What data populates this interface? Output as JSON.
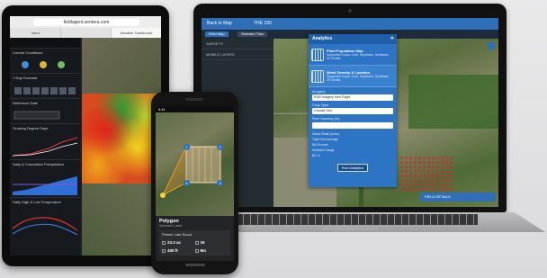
{
  "tablet": {
    "url": "fieldagent.sentera.com",
    "tabs": [
      "Inbox",
      "",
      "Weather Dashboard"
    ],
    "panels": [
      {
        "label": "Current Conditions"
      },
      {
        "label": "7-Day Forecast"
      },
      {
        "label": "Reference Date"
      },
      {
        "label": "Growing Degree Days"
      },
      {
        "label": "Daily & Cumulative Precipitation"
      },
      {
        "label": "Daily High & Low Temperature"
      }
    ],
    "colors": {
      "heat_red": "#e3251b",
      "heat_yellow": "#f2d21b",
      "heat_green": "#2b9a35"
    }
  },
  "laptop": {
    "topbar": {
      "back": "Back to Map",
      "field": "THE 100"
    },
    "nav": {
      "field_map": "Field Map",
      "selected": "Selected Tiles"
    },
    "sidebar": [
      "SURVEYS",
      "MOBILE LAYERS"
    ],
    "analytics": {
      "title": "Analytics",
      "close": "✕",
      "options": [
        {
          "name": "Plant Population Map",
          "desc": "Supported Crops: Corn, Soybeans, Sunflower",
          "extra": "20 Credits",
          "icon": "plant-population-icon",
          "icon_label": "Population"
        },
        {
          "name": "Weed Density & Location",
          "desc": "Supported Crops: Corn, Soybeans, Sunflower",
          "extra": "20 Credits",
          "icon": "weed-density-icon",
          "icon_label": "Weeds"
        }
      ],
      "imagery_label": "Imagery",
      "imagery_value": "RGB Imagery from Flight",
      "crop_label": "Crop Type",
      "crop_value": "Choose One",
      "row_spacing_label": "Row Spacing (in)",
      "seed_rate_label": "Seed Rate (s/ac)",
      "total_acreage_label": "Total Field Acreage",
      "total_acreage_value": "86.16 acres",
      "subtotal_label": "Subtotal Charge",
      "subtotal_value": "$0 / 0",
      "run_button": "Run Analytics"
    },
    "field_details": "FIELD DETAILS",
    "accent": "#2e6fb8"
  },
  "phone": {
    "status_time": "9:41",
    "panel_title": "Polygon",
    "panel_subtitle": "Selected 1 area",
    "card_title": "Preset: Late Scout",
    "stats": [
      {
        "icon": "area-icon",
        "value": "23.3 ac"
      },
      {
        "icon": "grid-icon",
        "value": "16"
      },
      {
        "icon": "altitude-icon",
        "value": "400 ft"
      },
      {
        "icon": "time-icon",
        "value": "8m"
      }
    ],
    "waypoints": [
      "1",
      "2",
      "3",
      "4"
    ]
  }
}
